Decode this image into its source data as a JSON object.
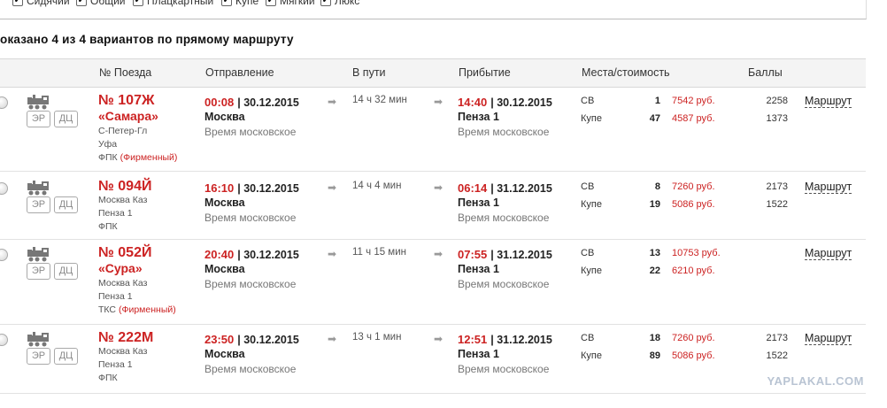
{
  "filters": [
    {
      "label": "Сидячий",
      "checked": true
    },
    {
      "label": "Общий",
      "checked": true
    },
    {
      "label": "Плацкартный",
      "checked": true
    },
    {
      "label": "Купе",
      "checked": true
    },
    {
      "label": "Мягкий",
      "checked": true
    },
    {
      "label": "Люкс",
      "checked": true
    }
  ],
  "subtitle": "оказано 4 из 4 вариантов по прямому маршруту",
  "columns": {
    "train": "№ Поезда",
    "departure": "Отправление",
    "duration": "В пути",
    "arrival": "Прибытие",
    "seats": "Места/стоимость",
    "points": "Баллы"
  },
  "badges": {
    "er": "ЭР",
    "dc": "ДЦ"
  },
  "icons": {
    "locomotive": "locomotive-icon",
    "arrow": "arrow-right-icon",
    "check": "✔",
    "arrow_glyph": "➡"
  },
  "colors": {
    "accent": "#cc2222",
    "header_bg": "#f4f4f4"
  },
  "trains": [
    {
      "number": "№ 107Ж",
      "name": "«Самара»",
      "route_from": "С-Петер-Гл",
      "route_to": "Уфа",
      "carrier": "ФПК",
      "carrier_note": "(Фирменный)",
      "dep_time": "00:08",
      "dep_date": "| 30.12.2015",
      "dep_city": "Москва",
      "dep_tz": "Время московское",
      "duration": "14 ч 32 мин",
      "arr_time": "14:40",
      "arr_date": "| 30.12.2015",
      "arr_city": "Пенза 1",
      "arr_tz": "Время московское",
      "classes": [
        {
          "type": "СВ",
          "seats": "1",
          "price": "7542 руб.",
          "points": "2258"
        },
        {
          "type": "Купе",
          "seats": "47",
          "price": "4587 руб.",
          "points": "1373"
        }
      ],
      "route_link": "Маршрут"
    },
    {
      "number": "№ 094Й",
      "name": "",
      "route_from": "Москва Каз",
      "route_to": "Пенза 1",
      "carrier": "ФПК",
      "carrier_note": "",
      "dep_time": "16:10",
      "dep_date": "| 30.12.2015",
      "dep_city": "Москва",
      "dep_tz": "Время московское",
      "duration": "14 ч 4 мин",
      "arr_time": "06:14",
      "arr_date": "| 31.12.2015",
      "arr_city": "Пенза 1",
      "arr_tz": "Время московское",
      "classes": [
        {
          "type": "СВ",
          "seats": "8",
          "price": "7260 руб.",
          "points": "2173"
        },
        {
          "type": "Купе",
          "seats": "19",
          "price": "5086 руб.",
          "points": "1522"
        }
      ],
      "route_link": "Маршрут"
    },
    {
      "number": "№ 052Й",
      "name": "«Сура»",
      "route_from": "Москва Каз",
      "route_to": "Пенза 1",
      "carrier": "ТКС",
      "carrier_note": "(Фирменный)",
      "dep_time": "20:40",
      "dep_date": "| 30.12.2015",
      "dep_city": "Москва",
      "dep_tz": "Время московское",
      "duration": "11 ч 15 мин",
      "arr_time": "07:55",
      "arr_date": "| 31.12.2015",
      "arr_city": "Пенза 1",
      "arr_tz": "Время московское",
      "classes": [
        {
          "type": "СВ",
          "seats": "13",
          "price": "10753 руб.",
          "points": ""
        },
        {
          "type": "Купе",
          "seats": "22",
          "price": "6210 руб.",
          "points": ""
        }
      ],
      "route_link": "Маршрут"
    },
    {
      "number": "№ 222М",
      "name": "",
      "route_from": "Москва Каз",
      "route_to": "Пенза 1",
      "carrier": "ФПК",
      "carrier_note": "",
      "dep_time": "23:50",
      "dep_date": "| 30.12.2015",
      "dep_city": "Москва",
      "dep_tz": "Время московское",
      "duration": "13 ч 1 мин",
      "arr_time": "12:51",
      "arr_date": "| 31.12.2015",
      "arr_city": "Пенза 1",
      "arr_tz": "Время московское",
      "classes": [
        {
          "type": "СВ",
          "seats": "18",
          "price": "7260 руб.",
          "points": "2173"
        },
        {
          "type": "Купе",
          "seats": "89",
          "price": "5086 руб.",
          "points": "1522"
        }
      ],
      "route_link": "Маршрут"
    }
  ],
  "watermark": "YAPLAKAL.COM"
}
